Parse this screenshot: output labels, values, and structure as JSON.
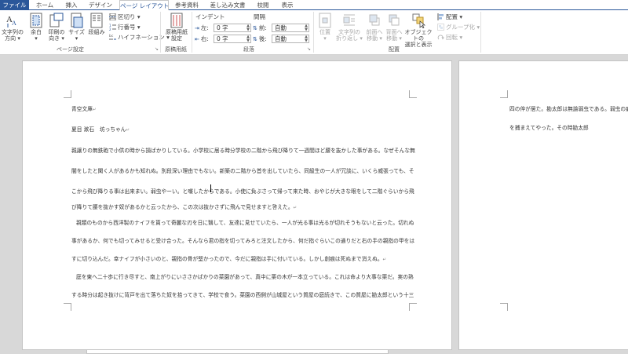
{
  "tabs": [
    {
      "label": "ファイル"
    },
    {
      "label": "ホーム"
    },
    {
      "label": "挿入"
    },
    {
      "label": "デザイン"
    },
    {
      "label": "ページ レイアウト"
    },
    {
      "label": "参考資料"
    },
    {
      "label": "差し込み文書"
    },
    {
      "label": "校閲"
    },
    {
      "label": "表示"
    }
  ],
  "ribbon": {
    "page_setup": {
      "text_direction": [
        "文字列の",
        "方向 ▾"
      ],
      "margins": [
        "余白",
        "▾"
      ],
      "orientation": [
        "印刷の",
        "向き ▾"
      ],
      "size": [
        "サイズ",
        "▾"
      ],
      "columns": "段組み",
      "breaks": "区切り ▾",
      "line_numbers": "行番号 ▾",
      "hyphenation": "ハイフネーション ▾",
      "group_label": "ページ設定"
    },
    "manuscript": {
      "button": [
        "原稿用紙",
        "設定"
      ],
      "group_label": "原稿用紙"
    },
    "paragraph": {
      "indent_header": "インデント",
      "spacing_header": "間隔",
      "left_label": "左:",
      "right_label": "右:",
      "left_value": "0 字",
      "right_value": "0 字",
      "before_label": "前:",
      "after_label": "後:",
      "before_value": "自動",
      "after_value": "自動",
      "group_label": "段落"
    },
    "arrange": {
      "position": [
        "位置",
        "▾"
      ],
      "wrap_text": [
        "文字列の",
        "折り返し ▾"
      ],
      "bring_forward": [
        "前面へ",
        "移動 ▾"
      ],
      "send_backward": [
        "背面へ",
        "移動 ▾"
      ],
      "selection_pane": [
        "オブジェクトの",
        "選択と表示"
      ],
      "align": "配置 ▾",
      "group": "グループ化 ▾",
      "rotate": "回転 ▾",
      "group_label": "配置"
    }
  },
  "document": {
    "page1_lines": [
      "青空文庫",
      "夏目 漱石　坊っちゃん",
      "親譲りの無鉄砲で小供の時から損ばかりしている。小学校に居る時分学校の二階から飛び降りて一週間ほど腰を抜かした事がある。なぜそんな無",
      "闇をしたと聞く人があるかも知れぬ。別段深い理由でもない。新築の二階から首を出していたら、同級生の一人が冗談に、いくら威張っても、そ",
      "こから飛び降りる事は出来まい。弱虫やーい。と囃したからである。小使に負ぶさって帰って来た時、おやじが大きな眼をして二階ぐらいから飛",
      "び降りて腰を抜かす奴があるかと云ったから、この次は抜かさずに飛んで見せますと答えた。",
      "親類のものから西洋製のナイフを貰って奇麗な刃を日に翳して、友達に見せていたら、一人が光る事は光るが切れそうもないと云った。切れぬ",
      "事があるか、何でも切ってみせると受け合った。そんなら君の指を切ってみろと注文したから、何だ指ぐらいこの通りだと右の手の親指の甲をは",
      "すに切り込んだ。幸ナイフが小さいのと、親指の骨が堅かったので、今だに親指は手に付いている。しかし創痕は死ぬまで消えぬ。",
      "庭を東へ二十歩に行き尽すと、南上がりにいささかばかりの菜園があって、真中に栗の木が一本立っている。これは命より大事な栗だ。実の熟",
      "する時分は起き抜けに背戸を出て落ちた奴を拾ってきて、学校で食う。菜園の西側が山城屋という質屋の庭続きで、この質屋に勘太郎という十三"
    ],
    "page2_lines": [
      "四の倅が居た。勘太郎は無論弱虫である。弱虫の癖",
      "を捕まえてやった。その時勘太郎"
    ]
  }
}
